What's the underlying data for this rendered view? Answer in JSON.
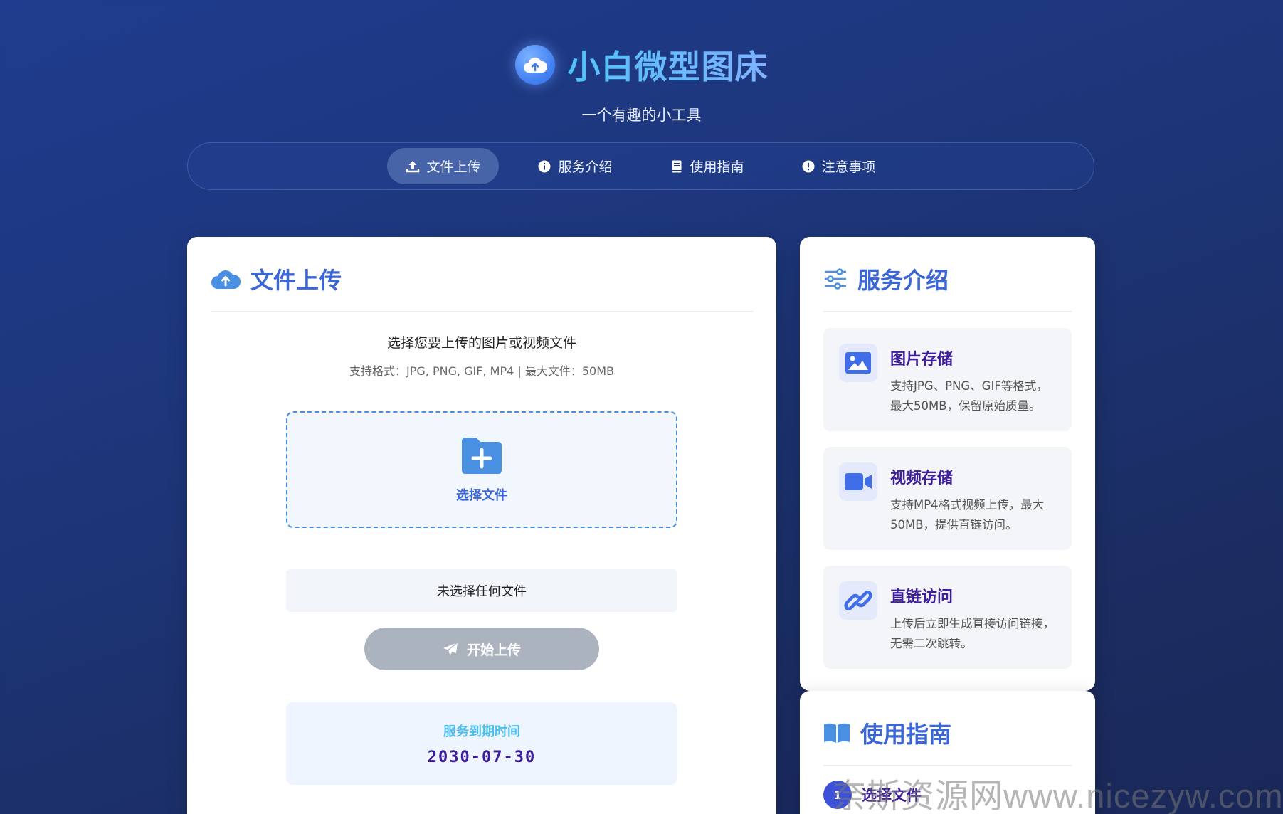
{
  "header": {
    "title": "小白微型图床",
    "subtitle": "一个有趣的小工具"
  },
  "nav": {
    "items": [
      {
        "label": "文件上传",
        "icon": "upload-icon",
        "active": true
      },
      {
        "label": "服务介绍",
        "icon": "info-icon",
        "active": false
      },
      {
        "label": "使用指南",
        "icon": "book-icon",
        "active": false
      },
      {
        "label": "注意事项",
        "icon": "exclamation-icon",
        "active": false
      }
    ]
  },
  "upload": {
    "title": "文件上传",
    "description": "选择您要上传的图片或视频文件",
    "formats": "支持格式：JPG, PNG, GIF, MP4 | 最大文件：50MB",
    "dropzone_label": "选择文件",
    "file_status": "未选择任何文件",
    "start_button": "开始上传",
    "expiry_label": "服务到期时间",
    "expiry_date": "2030-07-30"
  },
  "service": {
    "title": "服务介绍",
    "features": [
      {
        "title": "图片存储",
        "text": "支持JPG、PNG、GIF等格式，最大50MB，保留原始质量。",
        "icon": "image-icon"
      },
      {
        "title": "视频存储",
        "text": "支持MP4格式视频上传，最大50MB，提供直链访问。",
        "icon": "video-icon"
      },
      {
        "title": "直链访问",
        "text": "上传后立即生成直接访问链接，无需二次跳转。",
        "icon": "link-icon"
      }
    ]
  },
  "guide": {
    "title": "使用指南",
    "steps": [
      {
        "num": "1",
        "title": "选择文件"
      }
    ]
  },
  "watermark": "奈斯资源网www.nicezyw.com",
  "colors": {
    "accent": "#3b66d8",
    "feature_title": "#3d1d9b",
    "dropzone_border": "#4a90e2",
    "expiry_label": "#4fbde9",
    "button_disabled": "#abb3bf"
  }
}
